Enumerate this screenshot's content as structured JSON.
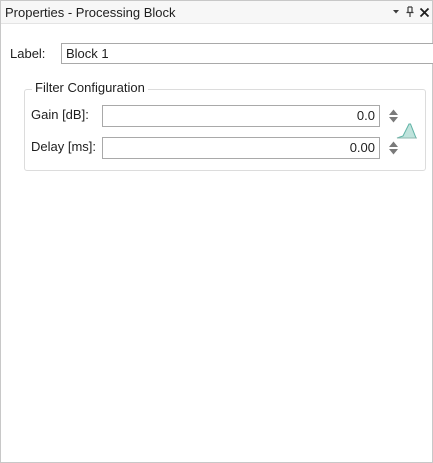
{
  "window": {
    "title": "Properties - Processing Block"
  },
  "label_field": {
    "caption": "Label:",
    "value": "Block 1"
  },
  "filter_group": {
    "title": "Filter Configuration",
    "gain": {
      "caption": "Gain [dB]:",
      "value": "0.0"
    },
    "delay": {
      "caption": "Delay [ms]:",
      "value": "0.00"
    }
  },
  "icons": {
    "dropdown": "dropdown-arrow-icon",
    "pin": "pin-icon",
    "close": "close-icon",
    "spinner": "up-down-spinner-icon",
    "filter": "filter-curve-icon"
  },
  "colors": {
    "filter_icon": "#5fb3a6",
    "spinner": "#7a7a7a"
  }
}
